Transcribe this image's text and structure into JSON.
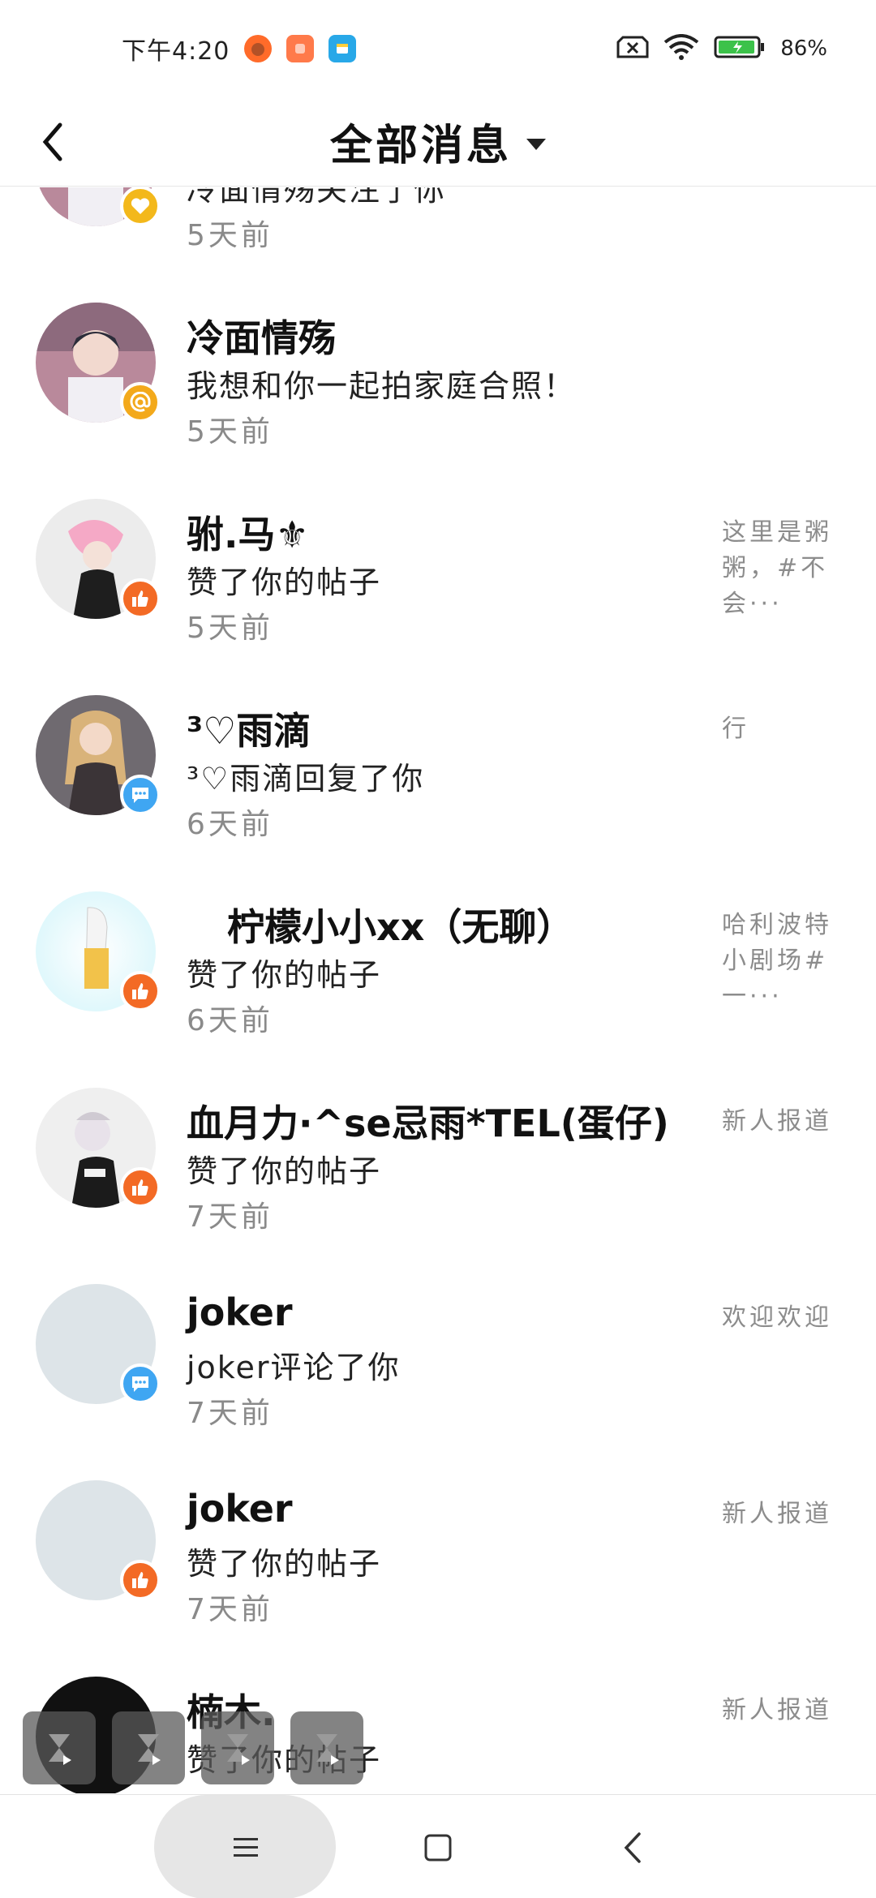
{
  "status": {
    "time": "下午4:20",
    "battery": "86%"
  },
  "header": {
    "title": "全部消息"
  },
  "messages": [
    {
      "name": "",
      "desc": "冷面情殇关注了你",
      "time": "5天前",
      "side": "",
      "badge": "follow-icon"
    },
    {
      "name": "冷面情殇",
      "desc": "我想和你一起拍家庭合照！",
      "time": "5天前",
      "side": "",
      "badge": "at-icon"
    },
    {
      "name": "驸.马⚜",
      "desc": "赞了你的帖子",
      "time": "5天前",
      "side": "这里是粥粥，#不会···",
      "badge": "like-icon"
    },
    {
      "name": "³♡雨滴",
      "desc": "³♡雨滴回复了你",
      "time": "6天前",
      "side": "行",
      "badge": "comment-icon"
    },
    {
      "name": "柠檬小小xx（无聊）",
      "desc": "赞了你的帖子",
      "time": "6天前",
      "side": "哈利波特小剧场#一···",
      "badge": "like-icon"
    },
    {
      "name": "血月力·^se忌雨*TEL(蛋仔)",
      "desc": "赞了你的帖子",
      "time": "7天前",
      "side": "新人报道",
      "badge": "like-icon"
    },
    {
      "name": "joker",
      "desc": "joker评论了你",
      "time": "7天前",
      "side": "欢迎欢迎",
      "badge": "comment-icon"
    },
    {
      "name": "joker",
      "desc": "赞了你的帖子",
      "time": "7天前",
      "side": "新人报道",
      "badge": "like-icon"
    },
    {
      "name": "楠木.",
      "desc": "赞了你的帖子",
      "time": "",
      "side": "新人报道",
      "badge": "like-icon"
    }
  ],
  "colors": {
    "like_badge": "#f36a25",
    "comment_badge": "#3fa6f2",
    "at_badge": "#f3a91b",
    "secondary_text": "#8a8a8a"
  }
}
